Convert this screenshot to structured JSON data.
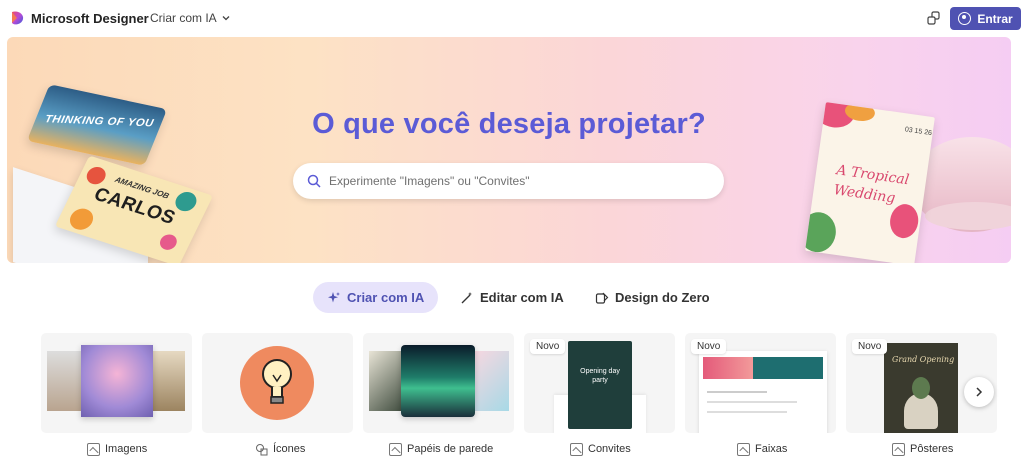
{
  "header": {
    "brand": "Microsoft Designer",
    "menu_label": "Criar com IA",
    "signin_label": "Entrar"
  },
  "hero": {
    "title": "O que você deseja projetar?",
    "search_placeholder": "Experimente \"Imagens\" ou \"Convites\"",
    "card_thinking_text": "THINKING OF YOU",
    "card_carlos_sub": "AMAZING JOB",
    "card_carlos_name": "CARLOS",
    "invite_title_line1": "A Tropical",
    "invite_title_line2": "Wedding",
    "invite_date": "03 15 26"
  },
  "modes": [
    {
      "label": "Criar com IA",
      "icon": "sparkle-icon",
      "active": true
    },
    {
      "label": "Editar com IA",
      "icon": "magic-wand-icon",
      "active": false
    },
    {
      "label": "Design do Zero",
      "icon": "design-icon",
      "active": false
    }
  ],
  "categories": [
    {
      "label": "Imagens",
      "badge": ""
    },
    {
      "label": "Ícones",
      "badge": ""
    },
    {
      "label": "Papéis de parede",
      "badge": ""
    },
    {
      "label": "Convites",
      "badge": "Novo"
    },
    {
      "label": "Faixas",
      "badge": "Novo"
    },
    {
      "label": "Pôsteres",
      "badge": "Novo"
    }
  ],
  "category_thumb_text": {
    "invite": "Opening day party",
    "poster": "Grand Opening"
  },
  "colors": {
    "accent": "#4f52b2",
    "hero_title": "#5b5bd6"
  }
}
